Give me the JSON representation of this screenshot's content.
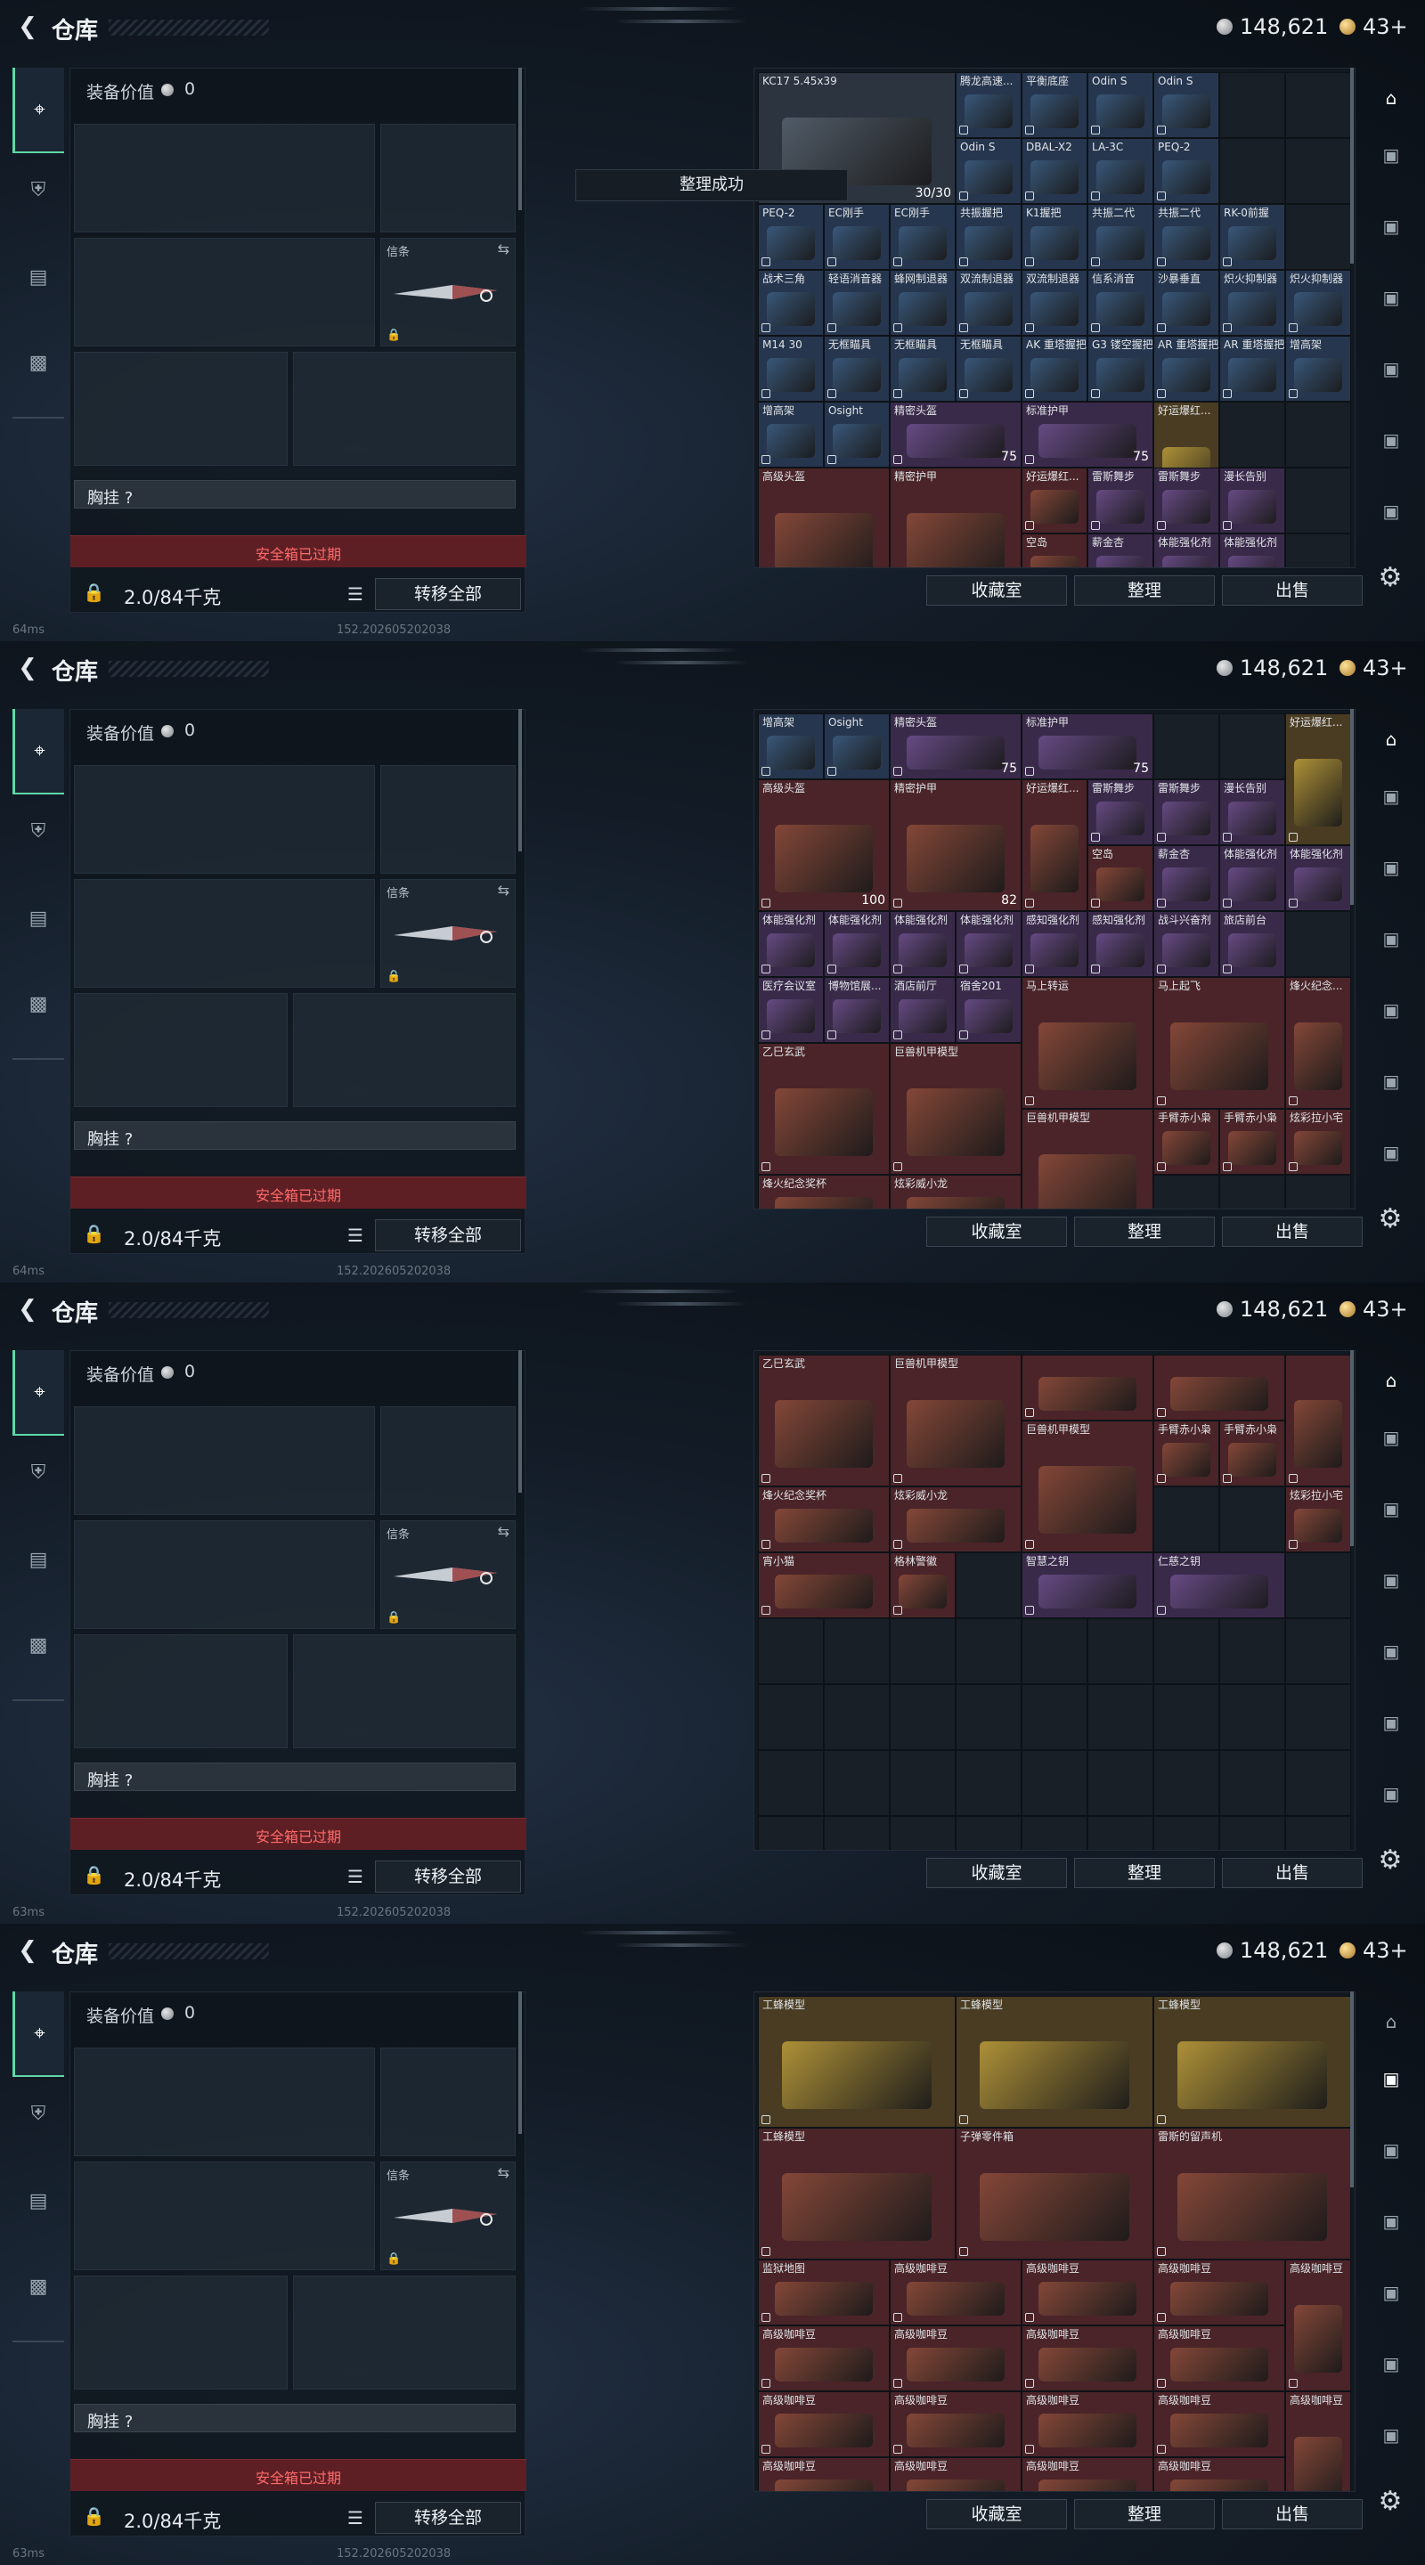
{
  "header": {
    "title": "仓库",
    "silver": "148,621",
    "gold": "43+"
  },
  "equipment": {
    "value_label": "装备价值",
    "value": "0",
    "melee_label": "信条",
    "chest_label": "胸挂 ?",
    "safe_box_text": "安全箱已过期",
    "transfer_label": "转移全部"
  },
  "screens": [
    {
      "ping": "64ms",
      "weight": "2.0/84千克"
    },
    {
      "ping": "64ms",
      "weight": "2.0/84千克"
    },
    {
      "ping": "63ms",
      "weight": "2.0/84千克"
    },
    {
      "ping": "63ms",
      "weight": "2.0/84千克"
    }
  ],
  "build": "152.202605202038",
  "toast": "整理成功",
  "footer": {
    "collection": "收藏室",
    "sort": "整理",
    "sell": "出售"
  },
  "icons": {
    "back": "chevron-left-icon",
    "silver": "silver-coin-icon",
    "gold": "gold-coin-icon",
    "weapon_tab": "gun-icon",
    "armor_tab": "helmet-icon",
    "clipboard_tab": "clipboard-icon",
    "case_tab": "briefcase-icon",
    "swap": "swap-icon",
    "lock": "lock-icon",
    "list": "list-icon",
    "settings": "gear-icon",
    "warehouse": "warehouse-icon",
    "storage": "storage-icon"
  },
  "colors": {
    "accent": "#5fd8a8",
    "alert": "#ff6a6a",
    "alert_bg": "#5e1f24"
  },
  "inventory_pages": [
    [
      {
        "c": 0,
        "r": 0,
        "w": 3,
        "h": 2,
        "t": "gray",
        "name": "KC17\n5.45x39",
        "qty": "30/30"
      },
      {
        "c": 3,
        "r": 0,
        "w": 1,
        "h": 1,
        "t": "blue",
        "name": "腾龙高速..."
      },
      {
        "c": 4,
        "r": 0,
        "w": 1,
        "h": 1,
        "t": "blue",
        "name": "平衡底座"
      },
      {
        "c": 5,
        "r": 0,
        "w": 1,
        "h": 1,
        "t": "blue",
        "name": "Odin S"
      },
      {
        "c": 6,
        "r": 0,
        "w": 1,
        "h": 1,
        "t": "blue",
        "name": "Odin S"
      },
      {
        "c": 3,
        "r": 1,
        "w": 1,
        "h": 1,
        "t": "blue",
        "name": "Odin S"
      },
      {
        "c": 4,
        "r": 1,
        "w": 1,
        "h": 1,
        "t": "blue",
        "name": "DBAL-X2"
      },
      {
        "c": 5,
        "r": 1,
        "w": 1,
        "h": 1,
        "t": "blue",
        "name": "LA-3C"
      },
      {
        "c": 6,
        "r": 1,
        "w": 1,
        "h": 1,
        "t": "blue",
        "name": "PEQ-2"
      },
      {
        "c": 0,
        "r": 2,
        "w": 1,
        "h": 1,
        "t": "blue",
        "name": "PEQ-2"
      },
      {
        "c": 1,
        "r": 2,
        "w": 1,
        "h": 1,
        "t": "blue",
        "name": "EC刚手"
      },
      {
        "c": 2,
        "r": 2,
        "w": 1,
        "h": 1,
        "t": "blue",
        "name": "EC刚手"
      },
      {
        "c": 3,
        "r": 2,
        "w": 1,
        "h": 1,
        "t": "blue",
        "name": "共振握把"
      },
      {
        "c": 4,
        "r": 2,
        "w": 1,
        "h": 1,
        "t": "blue",
        "name": "K1握把"
      },
      {
        "c": 5,
        "r": 2,
        "w": 1,
        "h": 1,
        "t": "blue",
        "name": "共振二代"
      },
      {
        "c": 6,
        "r": 2,
        "w": 1,
        "h": 1,
        "t": "blue",
        "name": "共振二代"
      },
      {
        "c": 7,
        "r": 2,
        "w": 1,
        "h": 1,
        "t": "blue",
        "name": "RK-0前握"
      },
      {
        "c": 0,
        "r": 3,
        "w": 1,
        "h": 1,
        "t": "blue",
        "name": "战术三角"
      },
      {
        "c": 1,
        "r": 3,
        "w": 1,
        "h": 1,
        "t": "blue",
        "name": "轻语消音器"
      },
      {
        "c": 2,
        "r": 3,
        "w": 1,
        "h": 1,
        "t": "blue",
        "name": "蜂网制退器"
      },
      {
        "c": 3,
        "r": 3,
        "w": 1,
        "h": 1,
        "t": "blue",
        "name": "双流制退器"
      },
      {
        "c": 4,
        "r": 3,
        "w": 1,
        "h": 1,
        "t": "blue",
        "name": "双流制退器"
      },
      {
        "c": 5,
        "r": 3,
        "w": 1,
        "h": 1,
        "t": "blue",
        "name": "信系消音"
      },
      {
        "c": 6,
        "r": 3,
        "w": 1,
        "h": 1,
        "t": "blue",
        "name": "沙暴垂直"
      },
      {
        "c": 7,
        "r": 3,
        "w": 1,
        "h": 1,
        "t": "blue",
        "name": "炽火抑制器"
      },
      {
        "c": 8,
        "r": 3,
        "w": 1,
        "h": 1,
        "t": "blue",
        "name": "炽火抑制器"
      },
      {
        "c": 0,
        "r": 4,
        "w": 1,
        "h": 1,
        "t": "blue",
        "name": "M14 30"
      },
      {
        "c": 1,
        "r": 4,
        "w": 1,
        "h": 1,
        "t": "blue",
        "name": "无框瞄具"
      },
      {
        "c": 2,
        "r": 4,
        "w": 1,
        "h": 1,
        "t": "blue",
        "name": "无框瞄具"
      },
      {
        "c": 3,
        "r": 4,
        "w": 1,
        "h": 1,
        "t": "blue",
        "name": "无框瞄具"
      },
      {
        "c": 4,
        "r": 4,
        "w": 1,
        "h": 1,
        "t": "blue",
        "name": "AK 重塔握把"
      },
      {
        "c": 5,
        "r": 4,
        "w": 1,
        "h": 1,
        "t": "blue",
        "name": "G3 镂空握把"
      },
      {
        "c": 6,
        "r": 4,
        "w": 1,
        "h": 1,
        "t": "blue",
        "name": "AR 重塔握把"
      },
      {
        "c": 7,
        "r": 4,
        "w": 1,
        "h": 1,
        "t": "blue",
        "name": "AR 重塔握把"
      },
      {
        "c": 8,
        "r": 4,
        "w": 1,
        "h": 1,
        "t": "blue",
        "name": "增高架"
      },
      {
        "c": 0,
        "r": 5,
        "w": 1,
        "h": 1,
        "t": "blue",
        "name": "增高架"
      },
      {
        "c": 1,
        "r": 5,
        "w": 1,
        "h": 1,
        "t": "blue",
        "name": "Osight"
      },
      {
        "c": 2,
        "r": 5,
        "w": 2,
        "h": 1,
        "t": "purple",
        "name": "精密头盔",
        "qty": "75"
      },
      {
        "c": 4,
        "r": 5,
        "w": 2,
        "h": 1,
        "t": "purple",
        "name": "标准护甲",
        "qty": "75"
      },
      {
        "c": 6,
        "r": 5,
        "w": 1,
        "h": 2,
        "t": "gold",
        "name": "好运爆红..."
      },
      {
        "c": 0,
        "r": 6,
        "w": 2,
        "h": 2,
        "t": "red",
        "name": "高级头盔"
      },
      {
        "c": 2,
        "r": 6,
        "w": 2,
        "h": 2,
        "t": "red",
        "name": "精密护甲"
      },
      {
        "c": 4,
        "r": 6,
        "w": 1,
        "h": 1,
        "t": "red",
        "name": "好运爆红..."
      },
      {
        "c": 5,
        "r": 6,
        "w": 1,
        "h": 1,
        "t": "purple",
        "name": "雷斯舞步"
      },
      {
        "c": 6,
        "r": 6,
        "w": 1,
        "h": 1,
        "t": "purple",
        "name": "雷斯舞步"
      },
      {
        "c": 7,
        "r": 6,
        "w": 1,
        "h": 1,
        "t": "purple",
        "name": "漫长告别"
      },
      {
        "c": 4,
        "r": 7,
        "w": 1,
        "h": 1,
        "t": "red",
        "name": "空岛"
      },
      {
        "c": 5,
        "r": 7,
        "w": 1,
        "h": 1,
        "t": "purple",
        "name": "薪金杏"
      },
      {
        "c": 6,
        "r": 7,
        "w": 1,
        "h": 1,
        "t": "purple",
        "name": "体能强化剂"
      },
      {
        "c": 7,
        "r": 7,
        "w": 1,
        "h": 1,
        "t": "purple",
        "name": "体能强化剂"
      }
    ],
    [
      {
        "c": 0,
        "r": 0,
        "w": 1,
        "h": 1,
        "t": "blue",
        "name": "增高架"
      },
      {
        "c": 1,
        "r": 0,
        "w": 1,
        "h": 1,
        "t": "blue",
        "name": "Osight"
      },
      {
        "c": 2,
        "r": 0,
        "w": 2,
        "h": 1,
        "t": "purple",
        "name": "精密头盔",
        "qty": "75"
      },
      {
        "c": 4,
        "r": 0,
        "w": 2,
        "h": 1,
        "t": "purple",
        "name": "标准护甲",
        "qty": "75"
      },
      {
        "c": 8,
        "r": 0,
        "w": 1,
        "h": 2,
        "t": "gold",
        "name": "好运爆红..."
      },
      {
        "c": 0,
        "r": 1,
        "w": 2,
        "h": 2,
        "t": "red",
        "name": "高级头盔",
        "qty": "100"
      },
      {
        "c": 2,
        "r": 1,
        "w": 2,
        "h": 2,
        "t": "red",
        "name": "精密护甲",
        "qty": "82"
      },
      {
        "c": 4,
        "r": 1,
        "w": 1,
        "h": 2,
        "t": "red",
        "name": "好运爆红..."
      },
      {
        "c": 5,
        "r": 1,
        "w": 1,
        "h": 1,
        "t": "purple",
        "name": "雷斯舞步"
      },
      {
        "c": 6,
        "r": 1,
        "w": 1,
        "h": 1,
        "t": "purple",
        "name": "雷斯舞步"
      },
      {
        "c": 7,
        "r": 1,
        "w": 1,
        "h": 1,
        "t": "purple",
        "name": "漫长告别"
      },
      {
        "c": 5,
        "r": 2,
        "w": 1,
        "h": 1,
        "t": "red",
        "name": "空岛"
      },
      {
        "c": 6,
        "r": 2,
        "w": 1,
        "h": 1,
        "t": "purple",
        "name": "薪金杏"
      },
      {
        "c": 7,
        "r": 2,
        "w": 1,
        "h": 1,
        "t": "purple",
        "name": "体能强化剂"
      },
      {
        "c": 8,
        "r": 2,
        "w": 1,
        "h": 1,
        "t": "purple",
        "name": "体能强化剂"
      },
      {
        "c": 0,
        "r": 3,
        "w": 1,
        "h": 1,
        "t": "purple",
        "name": "体能强化剂"
      },
      {
        "c": 1,
        "r": 3,
        "w": 1,
        "h": 1,
        "t": "purple",
        "name": "体能强化剂"
      },
      {
        "c": 2,
        "r": 3,
        "w": 1,
        "h": 1,
        "t": "purple",
        "name": "体能强化剂"
      },
      {
        "c": 3,
        "r": 3,
        "w": 1,
        "h": 1,
        "t": "purple",
        "name": "体能强化剂"
      },
      {
        "c": 4,
        "r": 3,
        "w": 1,
        "h": 1,
        "t": "purple",
        "name": "感知强化剂"
      },
      {
        "c": 5,
        "r": 3,
        "w": 1,
        "h": 1,
        "t": "purple",
        "name": "感知强化剂"
      },
      {
        "c": 6,
        "r": 3,
        "w": 1,
        "h": 1,
        "t": "purple",
        "name": "战斗兴奋剂"
      },
      {
        "c": 7,
        "r": 3,
        "w": 1,
        "h": 1,
        "t": "purple",
        "name": "旅店前台"
      },
      {
        "c": 0,
        "r": 4,
        "w": 1,
        "h": 1,
        "t": "purple",
        "name": "医疗会议室"
      },
      {
        "c": 1,
        "r": 4,
        "w": 1,
        "h": 1,
        "t": "purple",
        "name": "博物馆展..."
      },
      {
        "c": 2,
        "r": 4,
        "w": 1,
        "h": 1,
        "t": "purple",
        "name": "酒店前厅"
      },
      {
        "c": 3,
        "r": 4,
        "w": 1,
        "h": 1,
        "t": "purple",
        "name": "宿舍201"
      },
      {
        "c": 4,
        "r": 4,
        "w": 2,
        "h": 2,
        "t": "red",
        "name": "马上转运"
      },
      {
        "c": 6,
        "r": 4,
        "w": 2,
        "h": 2,
        "t": "red",
        "name": "马上起飞"
      },
      {
        "c": 8,
        "r": 4,
        "w": 1,
        "h": 2,
        "t": "red",
        "name": "烽火纪念..."
      },
      {
        "c": 0,
        "r": 5,
        "w": 2,
        "h": 2,
        "t": "red",
        "name": "乙巳玄武"
      },
      {
        "c": 2,
        "r": 5,
        "w": 2,
        "h": 2,
        "t": "red",
        "name": "巨兽机甲模型"
      },
      {
        "c": 4,
        "r": 6,
        "w": 2,
        "h": 2,
        "t": "red",
        "name": "巨兽机甲模型"
      },
      {
        "c": 6,
        "r": 6,
        "w": 1,
        "h": 1,
        "t": "red",
        "name": "手臂赤小枭"
      },
      {
        "c": 7,
        "r": 6,
        "w": 1,
        "h": 1,
        "t": "red",
        "name": "手臂赤小枭"
      },
      {
        "c": 8,
        "r": 6,
        "w": 1,
        "h": 1,
        "t": "red",
        "name": "炫彩拉小宅"
      },
      {
        "c": 0,
        "r": 7,
        "w": 2,
        "h": 1,
        "t": "red",
        "name": "烽火纪念奖杯"
      },
      {
        "c": 2,
        "r": 7,
        "w": 2,
        "h": 1,
        "t": "red",
        "name": "炫彩威小龙"
      }
    ],
    [
      {
        "c": 0,
        "r": 0,
        "w": 2,
        "h": 2,
        "t": "red",
        "name": "乙巳玄武"
      },
      {
        "c": 2,
        "r": 0,
        "w": 2,
        "h": 2,
        "t": "red",
        "name": "巨兽机甲模型"
      },
      {
        "c": 4,
        "r": 0,
        "w": 2,
        "h": 1,
        "t": "red",
        "name": ""
      },
      {
        "c": 6,
        "r": 0,
        "w": 2,
        "h": 1,
        "t": "red",
        "name": ""
      },
      {
        "c": 8,
        "r": 0,
        "w": 1,
        "h": 2,
        "t": "red",
        "name": ""
      },
      {
        "c": 4,
        "r": 1,
        "w": 2,
        "h": 2,
        "t": "red",
        "name": "巨兽机甲模型"
      },
      {
        "c": 6,
        "r": 1,
        "w": 1,
        "h": 1,
        "t": "red",
        "name": "手臂赤小枭"
      },
      {
        "c": 7,
        "r": 1,
        "w": 1,
        "h": 1,
        "t": "red",
        "name": "手臂赤小枭"
      },
      {
        "c": 8,
        "r": 2,
        "w": 1,
        "h": 1,
        "t": "red",
        "name": "炫彩拉小宅"
      },
      {
        "c": 0,
        "r": 2,
        "w": 2,
        "h": 1,
        "t": "red",
        "name": "烽火纪念奖杯"
      },
      {
        "c": 2,
        "r": 2,
        "w": 2,
        "h": 1,
        "t": "red",
        "name": "炫彩威小龙"
      },
      {
        "c": 0,
        "r": 3,
        "w": 2,
        "h": 1,
        "t": "red",
        "name": "宵小猫"
      },
      {
        "c": 2,
        "r": 3,
        "w": 1,
        "h": 1,
        "t": "red",
        "name": "格林警徽"
      },
      {
        "c": 4,
        "r": 3,
        "w": 2,
        "h": 1,
        "t": "purple",
        "name": "智慧之钥"
      },
      {
        "c": 6,
        "r": 3,
        "w": 2,
        "h": 1,
        "t": "purple",
        "name": "仁慈之钥"
      }
    ],
    [
      {
        "c": 0,
        "r": 0,
        "w": 3,
        "h": 2,
        "t": "gold",
        "name": "工蜂模型"
      },
      {
        "c": 3,
        "r": 0,
        "w": 3,
        "h": 2,
        "t": "gold",
        "name": "工蜂模型"
      },
      {
        "c": 6,
        "r": 0,
        "w": 3,
        "h": 2,
        "t": "gold",
        "name": "工蜂模型"
      },
      {
        "c": 0,
        "r": 2,
        "w": 3,
        "h": 2,
        "t": "red",
        "name": "工蜂模型"
      },
      {
        "c": 3,
        "r": 2,
        "w": 3,
        "h": 2,
        "t": "red",
        "name": "子弹零件箱"
      },
      {
        "c": 6,
        "r": 2,
        "w": 3,
        "h": 2,
        "t": "red",
        "name": "雷斯的留声机"
      },
      {
        "c": 0,
        "r": 4,
        "w": 2,
        "h": 1,
        "t": "red",
        "name": "监狱地图"
      },
      {
        "c": 2,
        "r": 4,
        "w": 2,
        "h": 1,
        "t": "red",
        "name": "高级咖啡豆"
      },
      {
        "c": 4,
        "r": 4,
        "w": 2,
        "h": 1,
        "t": "red",
        "name": "高级咖啡豆"
      },
      {
        "c": 6,
        "r": 4,
        "w": 2,
        "h": 1,
        "t": "red",
        "name": "高级咖啡豆"
      },
      {
        "c": 8,
        "r": 4,
        "w": 1,
        "h": 2,
        "t": "red",
        "name": "高级咖啡豆"
      },
      {
        "c": 0,
        "r": 5,
        "w": 2,
        "h": 1,
        "t": "red",
        "name": "高级咖啡豆"
      },
      {
        "c": 2,
        "r": 5,
        "w": 2,
        "h": 1,
        "t": "red",
        "name": "高级咖啡豆"
      },
      {
        "c": 4,
        "r": 5,
        "w": 2,
        "h": 1,
        "t": "red",
        "name": "高级咖啡豆"
      },
      {
        "c": 6,
        "r": 5,
        "w": 2,
        "h": 1,
        "t": "red",
        "name": "高级咖啡豆"
      },
      {
        "c": 0,
        "r": 6,
        "w": 2,
        "h": 1,
        "t": "red",
        "name": "高级咖啡豆"
      },
      {
        "c": 2,
        "r": 6,
        "w": 2,
        "h": 1,
        "t": "red",
        "name": "高级咖啡豆"
      },
      {
        "c": 4,
        "r": 6,
        "w": 2,
        "h": 1,
        "t": "red",
        "name": "高级咖啡豆"
      },
      {
        "c": 6,
        "r": 6,
        "w": 2,
        "h": 1,
        "t": "red",
        "name": "高级咖啡豆"
      },
      {
        "c": 8,
        "r": 6,
        "w": 1,
        "h": 2,
        "t": "red",
        "name": "高级咖啡豆"
      },
      {
        "c": 0,
        "r": 7,
        "w": 2,
        "h": 1,
        "t": "red",
        "name": "高级咖啡豆"
      },
      {
        "c": 2,
        "r": 7,
        "w": 2,
        "h": 1,
        "t": "red",
        "name": "高级咖啡豆"
      },
      {
        "c": 4,
        "r": 7,
        "w": 2,
        "h": 1,
        "t": "red",
        "name": "高级咖啡豆"
      },
      {
        "c": 6,
        "r": 7,
        "w": 2,
        "h": 1,
        "t": "red",
        "name": "高级咖啡豆"
      }
    ]
  ]
}
